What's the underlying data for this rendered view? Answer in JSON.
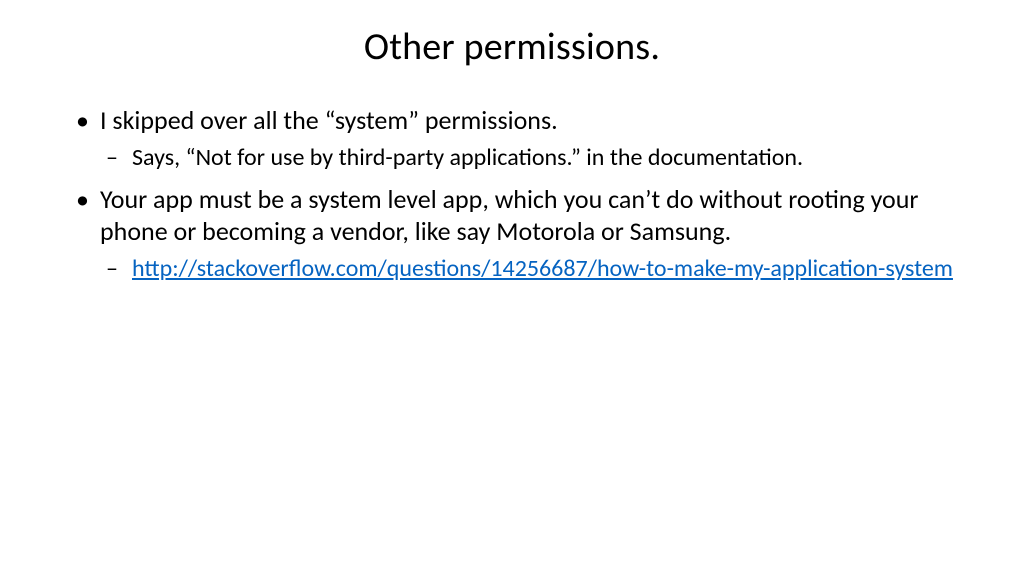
{
  "slide": {
    "title": "Other permissions.",
    "bullets": [
      {
        "text": "I skipped over all the “system” permissions.",
        "subbullets": [
          {
            "type": "text",
            "text": "Says, “Not for use by third-party applications.” in the documentation."
          }
        ]
      },
      {
        "text": "Your app must be a system level app, which you can’t do without rooting your phone or becoming a vendor, like say Motorola or Samsung.",
        "subbullets": [
          {
            "type": "link",
            "text": "http://stackoverflow.com/questions/14256687/how-to-make-my-application-system"
          }
        ]
      }
    ]
  }
}
